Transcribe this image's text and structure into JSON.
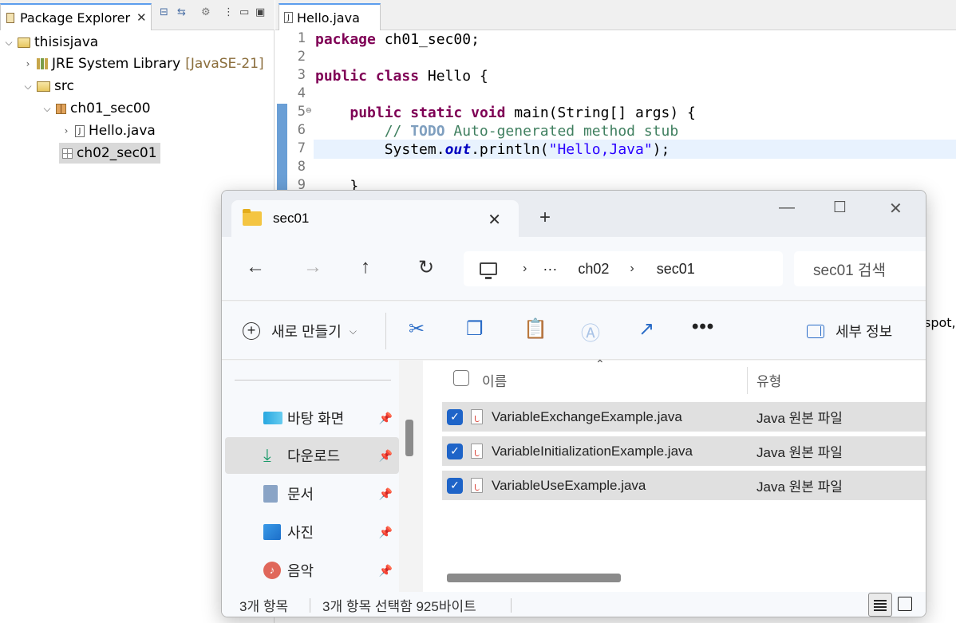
{
  "package_explorer": {
    "tab_title": "Package Explorer",
    "tree": [
      {
        "label": "thisisjava",
        "extra": ""
      },
      {
        "label": "JRE System Library",
        "extra": "[JavaSE-21]"
      },
      {
        "label": "src",
        "extra": ""
      },
      {
        "label": "ch01_sec00",
        "extra": ""
      },
      {
        "label": "Hello.java",
        "extra": ""
      },
      {
        "label": "ch02_sec01",
        "extra": ""
      }
    ]
  },
  "editor": {
    "tab_title": "Hello.java",
    "line_numbers": [
      "1",
      "2",
      "3",
      "4",
      "5",
      "6",
      "7",
      "8",
      "9"
    ],
    "lines": {
      "l1_kw": "package",
      "l1_rest": " ch01_sec00;",
      "l3_kw1": "public",
      "l3_kw2": "class",
      "l3_rest": " Hello {",
      "l5_kw1": "public",
      "l5_kw2": "static",
      "l5_kw3": "void",
      "l5_rest": " main(String[] args) {",
      "l6_comment1": "// ",
      "l6_todo": "TODO",
      "l6_comment2": " Auto-generated method stub",
      "l7_pre": "System.",
      "l7_field": "out",
      "l7_mid": ".println(",
      "l7_str": "\"Hello,Java\"",
      "l7_post": ");",
      "l9": "}"
    },
    "partial_text": "spot,"
  },
  "explorer": {
    "tab_title": "sec01",
    "address": {
      "ellipsis": "···",
      "crumb1": "ch02",
      "crumb2": "sec01"
    },
    "search_placeholder": "sec01 검색",
    "toolbar": {
      "new_label": "새로 만들기",
      "details_label": "세부 정보"
    },
    "sidebar": [
      {
        "label": "바탕 화면"
      },
      {
        "label": "다운로드"
      },
      {
        "label": "문서"
      },
      {
        "label": "사진"
      },
      {
        "label": "음악"
      }
    ],
    "columns": {
      "name": "이름",
      "type": "유형"
    },
    "files": [
      {
        "name": "VariableExchangeExample.java",
        "type": "Java 원본 파일"
      },
      {
        "name": "VariableInitializationExample.java",
        "type": "Java 원본 파일"
      },
      {
        "name": "VariableUseExample.java",
        "type": "Java 원본 파일"
      }
    ],
    "status": {
      "count": "3개 항목",
      "selected": "3개 항목 선택함 925바이트"
    }
  },
  "colors": {
    "accent": "#1e64c8",
    "keyword": "#7f0055",
    "comment": "#3f7f5f",
    "string": "#2a00ff"
  }
}
